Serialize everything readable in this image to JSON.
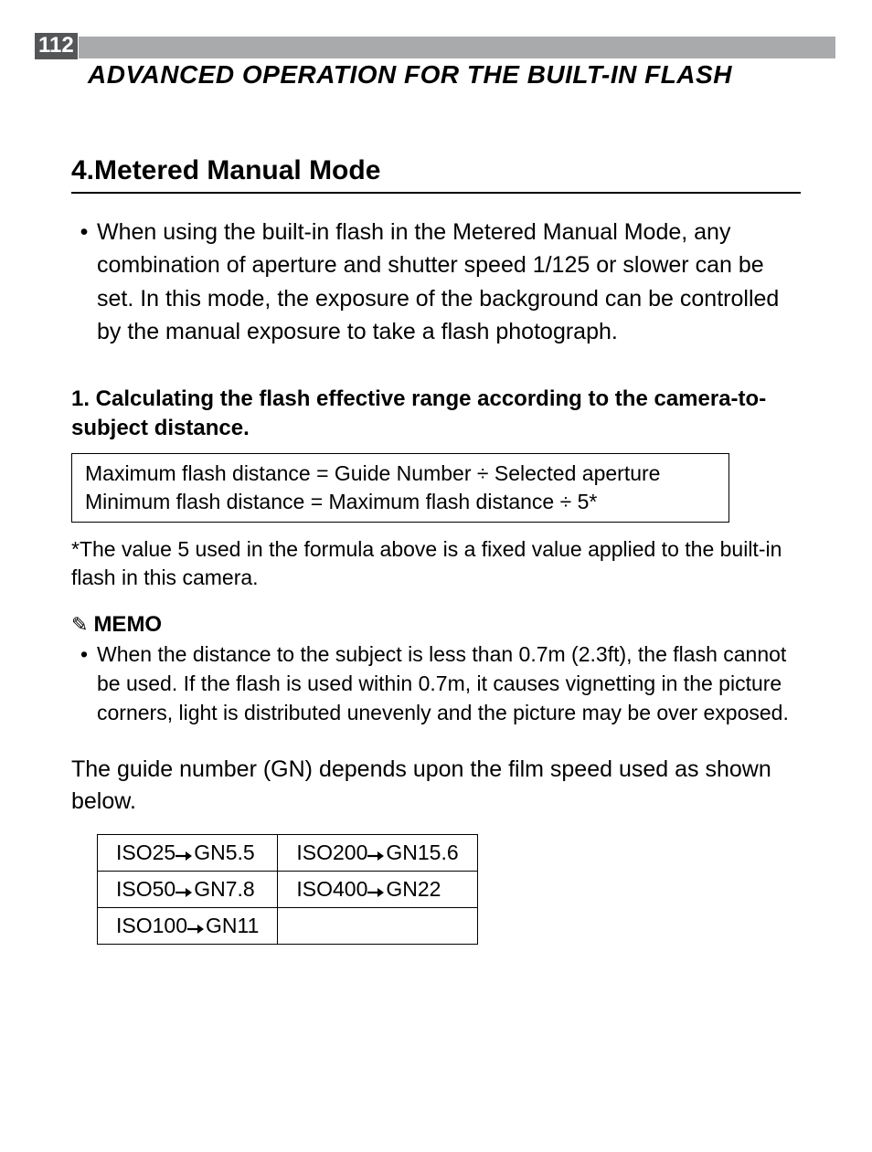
{
  "page_number": "112",
  "header_title": "ADVANCED OPERATION FOR THE BUILT-IN FLASH",
  "section_title": "4.Metered Manual Mode",
  "intro_bullet": "When using the built-in flash in the Metered Manual Mode, any combination of aperture and shutter speed 1/125 or slower can be set. In this mode, the exposure of the background can be controlled by the manual exposure to take a flash photograph.",
  "sub_head": "1. Calculating the flash effective range according to the camera-to-subject distance.",
  "formula": {
    "line1": "Maximum flash distance = Guide Number ÷ Selected aperture",
    "line2": "Minimum flash distance = Maximum flash distance ÷ 5*"
  },
  "footnote": "*The value 5 used in the formula above is a fixed value applied to the built-in flash in this camera.",
  "memo": {
    "icon": "✎",
    "label": "MEMO",
    "bullet": "When the distance to the subject is less than 0.7m (2.3ft), the flash cannot be used. If the flash is used within 0.7m, it causes vignetting in the picture corners, light is distributed unevenly and the picture may be over exposed."
  },
  "gn_intro": "The guide number (GN) depends upon the film speed used as shown below.",
  "gn_table": [
    [
      {
        "iso": "ISO25",
        "gn": "GN5.5"
      },
      {
        "iso": "ISO200",
        "gn": "GN15.6"
      }
    ],
    [
      {
        "iso": "ISO50",
        "gn": "GN7.8"
      },
      {
        "iso": "ISO400",
        "gn": "GN22"
      }
    ],
    [
      {
        "iso": "ISO100",
        "gn": "GN11"
      },
      null
    ]
  ]
}
